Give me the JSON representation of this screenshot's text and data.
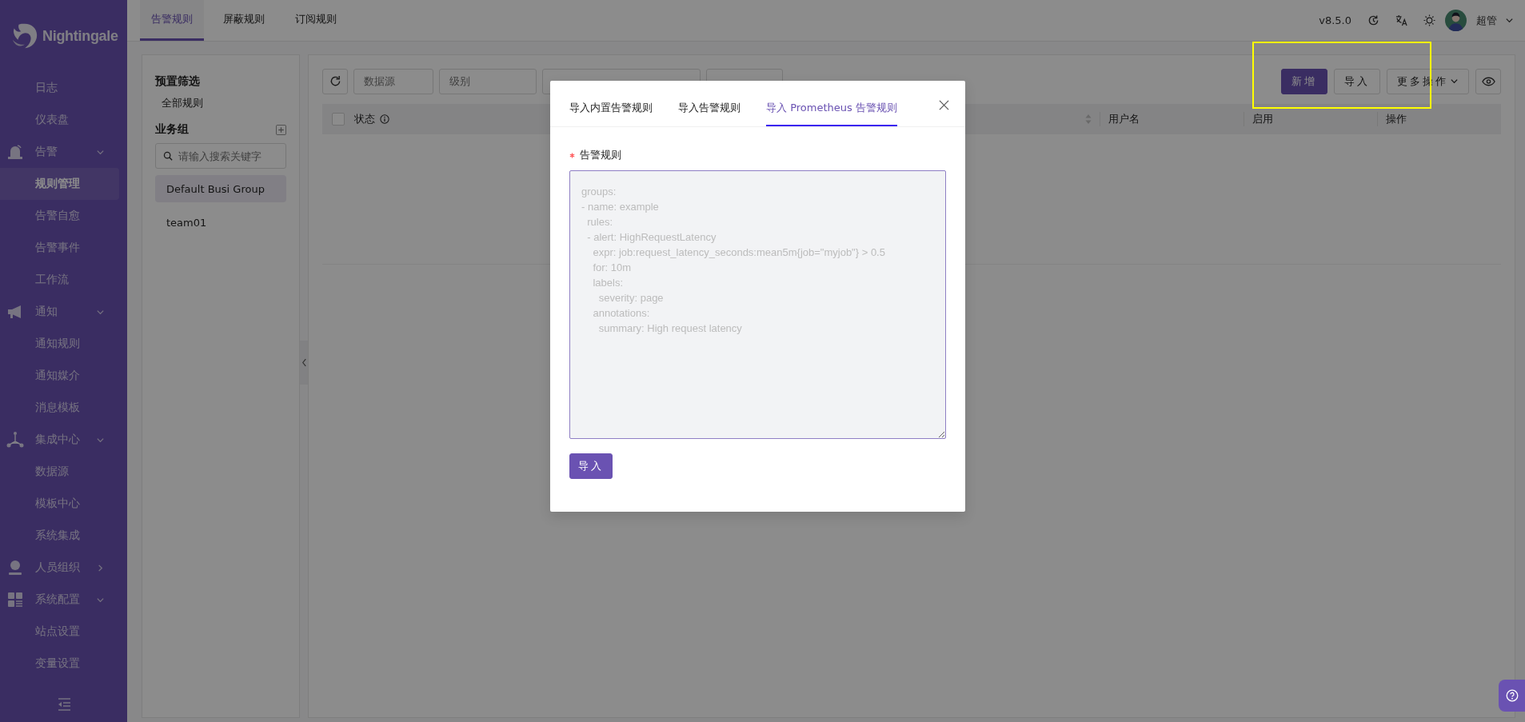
{
  "sidebar": {
    "logo": "Nightingale",
    "items": [
      {
        "kind": "link",
        "label": "日志",
        "selected": false
      },
      {
        "kind": "link",
        "label": "仪表盘",
        "selected": false
      },
      {
        "kind": "group",
        "label": "告警",
        "expanded": true,
        "children": [
          {
            "label": "规则管理",
            "selected": true
          },
          {
            "label": "告警自愈",
            "selected": false
          },
          {
            "label": "告警事件",
            "selected": false
          },
          {
            "label": "工作流",
            "selected": false
          }
        ]
      },
      {
        "kind": "group",
        "label": "通知",
        "expanded": true,
        "children": [
          {
            "label": "通知规则",
            "selected": false
          },
          {
            "label": "通知媒介",
            "selected": false
          },
          {
            "label": "消息模板",
            "selected": false
          }
        ]
      },
      {
        "kind": "group",
        "label": "集成中心",
        "expanded": true,
        "children": [
          {
            "label": "数据源",
            "selected": false
          },
          {
            "label": "模板中心",
            "selected": false
          },
          {
            "label": "系统集成",
            "selected": false
          }
        ]
      },
      {
        "kind": "group",
        "label": "人员组织",
        "expanded": false
      },
      {
        "kind": "group",
        "label": "系统配置",
        "expanded": true,
        "children": [
          {
            "label": "站点设置",
            "selected": false
          },
          {
            "label": "变量设置",
            "selected": false
          }
        ]
      }
    ]
  },
  "topbar": {
    "tabs": [
      {
        "label": "告警规则",
        "selected": true
      },
      {
        "label": "屏蔽规则",
        "selected": false
      },
      {
        "label": "订阅规则",
        "selected": false
      }
    ],
    "version": "v8.5.0",
    "user": "超管"
  },
  "left_panel": {
    "preset_title": "预置筛选",
    "presets": [
      {
        "label": "全部规则",
        "selected": false
      }
    ],
    "group_title": "业务组",
    "group_search": {
      "placeholder": "请输入搜索关键字"
    },
    "groups": [
      {
        "label": "Default Busi Group",
        "selected": true
      },
      {
        "label": "team01",
        "selected": false
      }
    ]
  },
  "toolbar": {
    "filters": [
      {
        "kind": "input",
        "placeholder": "数据源"
      },
      {
        "kind": "input",
        "placeholder": "级别"
      },
      {
        "kind": "search"
      },
      {
        "kind": "select"
      }
    ],
    "actions": [
      {
        "kind": "primary",
        "label": "新增"
      },
      {
        "kind": "default",
        "label": "导入"
      },
      {
        "kind": "dropdown",
        "label": "更多操作"
      }
    ]
  },
  "table": {
    "select_all": {
      "checked": false
    },
    "columns": [
      {
        "label": "状态",
        "info": true
      },
      {
        "sortable": true
      },
      {
        "label": "用户名"
      },
      {
        "label": "启用"
      },
      {
        "label": "操作"
      }
    ]
  },
  "modal": {
    "tabs": [
      {
        "label": "导入内置告警规则",
        "selected": false
      },
      {
        "label": "导入告警规则",
        "selected": false
      },
      {
        "label": "导入 Prometheus 告警规则",
        "selected": true
      }
    ],
    "field": {
      "label": "告警规则",
      "required": true,
      "placeholder": "groups:\n- name: example\n  rules:\n  - alert: HighRequestLatency\n    expr: job:request_latency_seconds:mean5m{job=\"myjob\"} > 0.5\n    for: 10m\n    labels:\n      severity: page\n    annotations:\n      summary: High request latency"
    },
    "submit": "导入"
  }
}
